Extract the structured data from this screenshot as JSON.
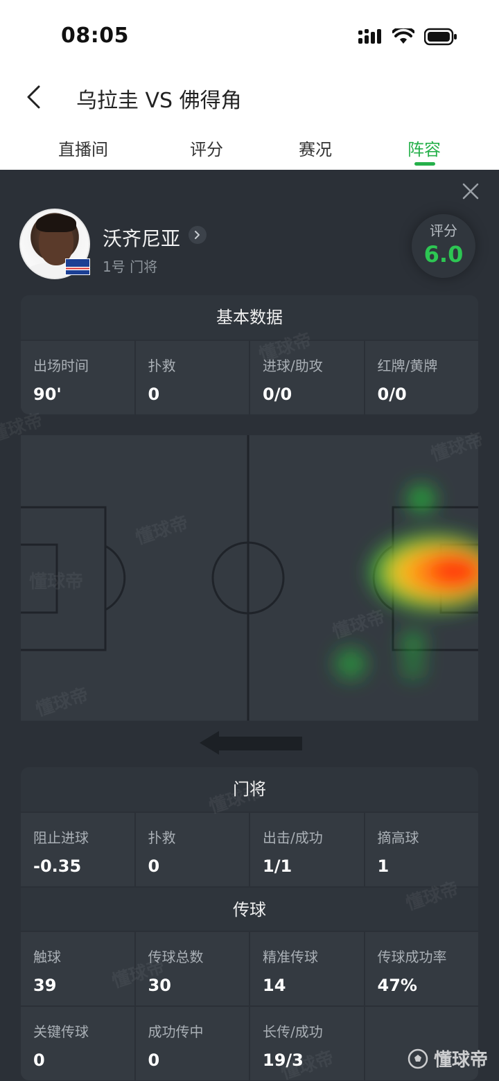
{
  "status_bar": {
    "time": "08:05"
  },
  "header": {
    "title": "乌拉圭 VS 佛得角"
  },
  "tabs": [
    {
      "label": "直播间"
    },
    {
      "label": "评分"
    },
    {
      "label": "赛况"
    },
    {
      "label": "阵容",
      "active": true
    }
  ],
  "player": {
    "name": "沃齐尼亚",
    "position": "1号 门将",
    "rating_label": "评分",
    "rating_value": "6.0"
  },
  "basic_stats": {
    "title": "基本数据",
    "items": [
      {
        "label": "出场时间",
        "value": "90'"
      },
      {
        "label": "扑救",
        "value": "0"
      },
      {
        "label": "进球/助攻",
        "value": "0/0"
      },
      {
        "label": "红牌/黄牌",
        "value": "0/0"
      }
    ]
  },
  "heatmap": {
    "attack_direction": "left"
  },
  "goalkeeper_stats": {
    "title": "门将",
    "items": [
      {
        "label": "阻止进球",
        "value": "-0.35"
      },
      {
        "label": "扑救",
        "value": "0"
      },
      {
        "label": "出击/成功",
        "value": "1/1"
      },
      {
        "label": "摘高球",
        "value": "1"
      }
    ]
  },
  "passing_stats": {
    "title": "传球",
    "row1": [
      {
        "label": "触球",
        "value": "39"
      },
      {
        "label": "传球总数",
        "value": "30"
      },
      {
        "label": "精准传球",
        "value": "14"
      },
      {
        "label": "传球成功率",
        "value": "47%"
      }
    ],
    "row2": [
      {
        "label": "关键传球",
        "value": "0"
      },
      {
        "label": "成功传中",
        "value": "0"
      },
      {
        "label": "长传/成功",
        "value": "19/3"
      }
    ]
  },
  "watermark": "懂球帝",
  "brand": "懂球帝",
  "colors": {
    "accent": "#25b04a",
    "rating": "#2dc653",
    "panel": "#2b3037"
  }
}
